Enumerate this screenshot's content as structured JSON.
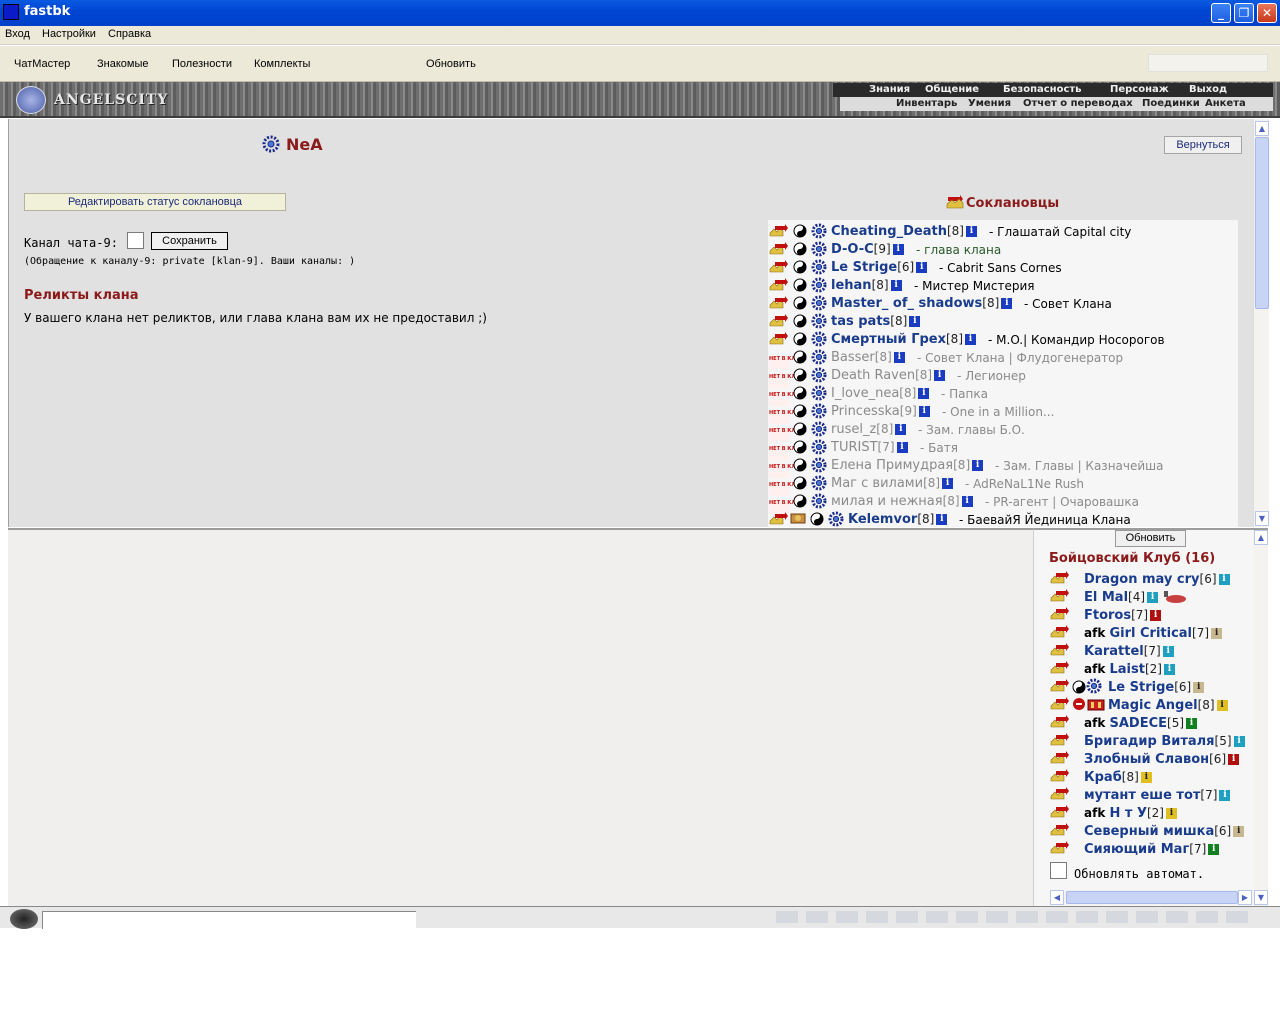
{
  "window": {
    "title": "fastbk",
    "minimize": "_",
    "maximize": "❐",
    "close": "✕"
  },
  "menu": [
    "Вход",
    "Настройки",
    "Справка"
  ],
  "toolbar": [
    "ЧатМастер",
    "Знакомые",
    "Полезности",
    "Комплекты",
    "Обновить"
  ],
  "game": {
    "logo": "ANGELSCITY",
    "nav_top": [
      "Знания",
      "Общение",
      "Безопасность",
      "Персонаж",
      "Выход"
    ],
    "nav_bottom": [
      "Инвентарь",
      "Умения",
      "Отчет о переводах",
      "Поединки",
      "Анкета"
    ]
  },
  "profile": {
    "nick": "NeA",
    "back_label": "Вернуться",
    "edit_status_label": "Редактировать статус соклановца",
    "channel_label": "Канал чата-9:",
    "save_label": "Сохранить",
    "channel_hint": "(Обращение к каналу-9: private [klan-9]. Ваши каналы: )",
    "relics_title": "Реликты клана",
    "relics_text": "У вашего клана нет реликтов, или глава клана вам их не предоставил ;)"
  },
  "clan": {
    "title": "Соклановцы",
    "offline_badge": "НЕТ В КЛУБЕ",
    "members": [
      {
        "name": "Cheating_Death",
        "level": "[8]",
        "status": "- Глашатай Capital city",
        "online": true
      },
      {
        "name": "D-O-C",
        "level": "[9]",
        "status": "- глава клана",
        "online": true,
        "head": true
      },
      {
        "name": "Le Strige",
        "level": "[6]",
        "status": "- Cabrit Sans Cornes",
        "online": true
      },
      {
        "name": "lehan",
        "level": "[8]",
        "status": "- Мистер Мистерия",
        "online": true
      },
      {
        "name": "Master_ of_ shadows",
        "level": "[8]",
        "status": "- Совет Клана",
        "online": true
      },
      {
        "name": "tas pats",
        "level": "[8]",
        "status": "",
        "online": true
      },
      {
        "name": "Смертный Грех",
        "level": "[8]",
        "status": "- M.O.| Командир Носорогов",
        "online": true
      },
      {
        "name": "Basser",
        "level": "[8]",
        "status": "- Совет Клана | Флудогенератор",
        "online": false
      },
      {
        "name": "Death Raven",
        "level": "[8]",
        "status": "- Легионер",
        "online": false
      },
      {
        "name": "I_love_nea",
        "level": "[8]",
        "status": "- Папка",
        "online": false
      },
      {
        "name": "Princesska",
        "level": "[9]",
        "status": "- One in a Million...",
        "online": false
      },
      {
        "name": "rusel_z",
        "level": "[8]",
        "status": "- Зам. главы Б.О.",
        "online": false
      },
      {
        "name": "TURIST",
        "level": "[7]",
        "status": "- Батя",
        "online": false
      },
      {
        "name": "Елена Примудрая",
        "level": "[8]",
        "status": "- Зам. Главы | Казначейша",
        "online": false
      },
      {
        "name": "Маг с вилами",
        "level": "[8]",
        "status": "- AdReNaL1Ne Rush",
        "online": false
      },
      {
        "name": "милая и нежная",
        "level": "[8]",
        "status": "- PR-агент | Очаровашка",
        "online": false
      },
      {
        "name": "Kelemvor",
        "level": "[8]",
        "status": "- БаевайЯ Йединица Клана",
        "online": true
      }
    ]
  },
  "online": {
    "refresh_label": "Обновить",
    "title": "Бойцовский Клуб (16)",
    "auto_refresh_label": "Обновлять автомат.",
    "users": [
      {
        "afk": "",
        "name": "Dragon may cry",
        "level": "[6]",
        "info": "teal"
      },
      {
        "afk": "",
        "name": "El Mal",
        "level": "[4]",
        "info": "teal"
      },
      {
        "afk": "",
        "name": "Ftoros",
        "level": "[7]",
        "info": "red"
      },
      {
        "afk": "afk",
        "name": "Girl Critical",
        "level": "[7]",
        "info": "olive"
      },
      {
        "afk": "",
        "name": "Karattel",
        "level": "[7]",
        "info": "teal"
      },
      {
        "afk": "afk",
        "name": "Laist",
        "level": "[2]",
        "info": "teal"
      },
      {
        "afk": "",
        "name": "Le Strige",
        "level": "[6]",
        "info": "olive"
      },
      {
        "afk": "",
        "name": "Magic Angel",
        "level": "[8]",
        "info": "gold"
      },
      {
        "afk": "afk",
        "name": "SADECE",
        "level": "[5]",
        "info": "green"
      },
      {
        "afk": "",
        "name": "Бригадир Виталя",
        "level": "[5]",
        "info": "teal"
      },
      {
        "afk": "",
        "name": "Злобный Славон",
        "level": "[6]",
        "info": "red"
      },
      {
        "afk": "",
        "name": "Краб",
        "level": "[8]",
        "info": "gold"
      },
      {
        "afk": "",
        "name": "мутант еше тот",
        "level": "[7]",
        "info": "teal"
      },
      {
        "afk": "afk",
        "name": "Н т У",
        "level": "[2]",
        "info": "gold"
      },
      {
        "afk": "",
        "name": "Северный мишка",
        "level": "[6]",
        "info": "olive"
      },
      {
        "afk": "",
        "name": "Сияющий Маг",
        "level": "[7]",
        "info": "green"
      }
    ]
  }
}
